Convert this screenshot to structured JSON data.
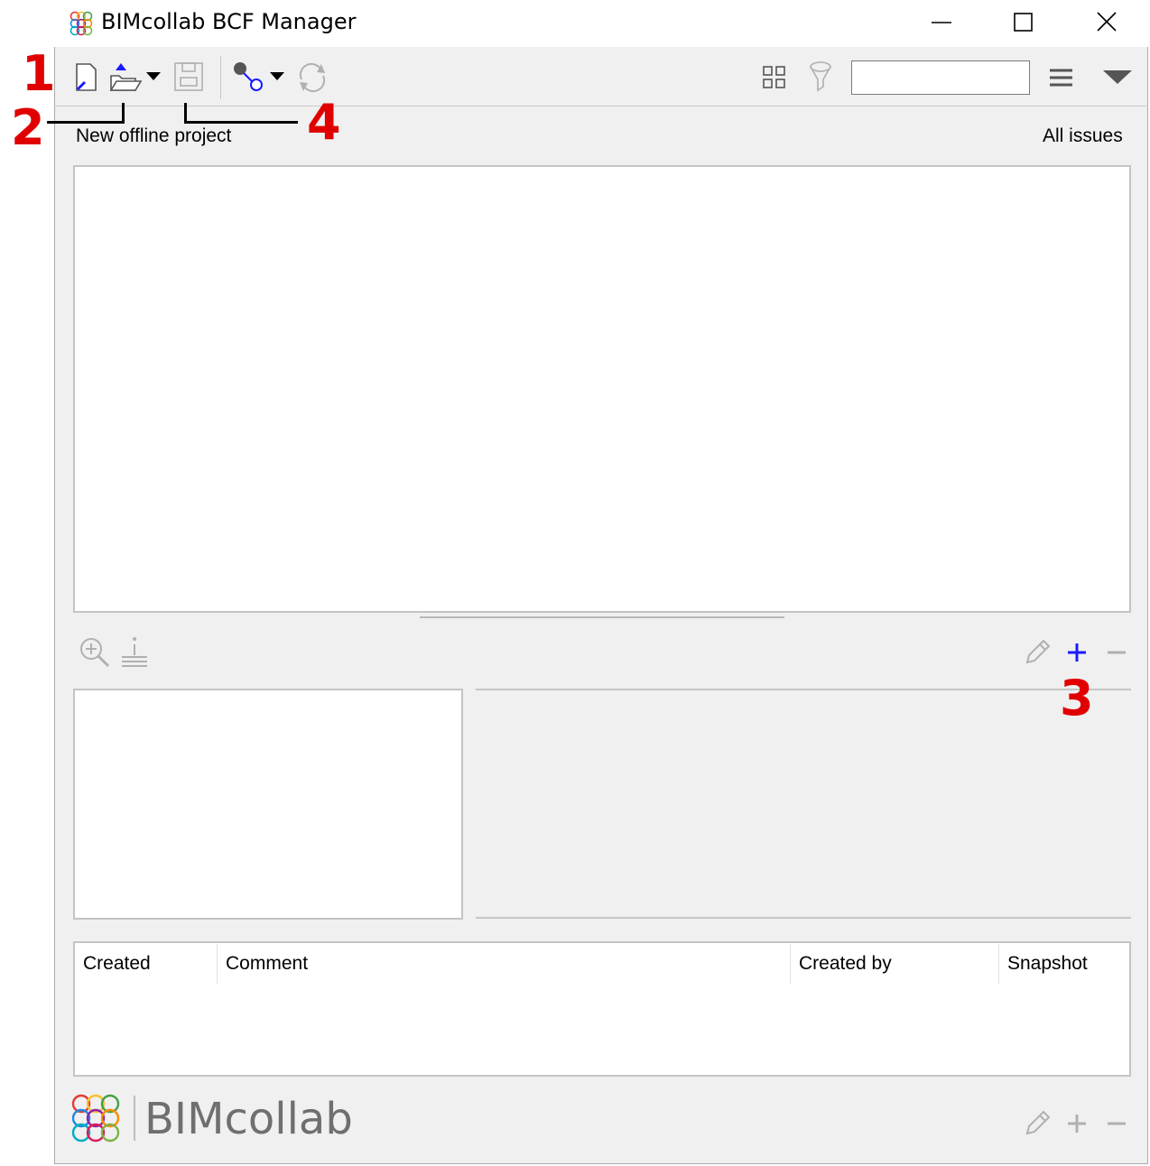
{
  "window": {
    "title": "BIMcollab BCF Manager",
    "minimize_label": "—",
    "maximize_label": "☐",
    "close_label": "✕"
  },
  "project": {
    "name": "New offline project",
    "filter_label": "All issues"
  },
  "search": {
    "value": "",
    "placeholder": ""
  },
  "comments_table": {
    "columns": [
      "Created",
      "Comment",
      "Created by",
      "Snapshot"
    ]
  },
  "branding": {
    "text": "BIMcollab"
  },
  "annotations": [
    "1",
    "2",
    "3",
    "4"
  ],
  "colors": {
    "accent_blue": "#1a1aff",
    "annotation_red": "#e00000",
    "disabled_gray": "#b0b0b0"
  },
  "icons": [
    "app-logo-icon",
    "new-project-icon",
    "open-folder-icon",
    "dropdown-arrow-icon",
    "save-icon",
    "connect-icon",
    "sync-icon",
    "grid-view-icon",
    "filter-icon",
    "menu-icon",
    "collapse-arrow-icon",
    "zoom-icon",
    "markup-icon",
    "edit-icon",
    "add-icon",
    "remove-icon"
  ]
}
